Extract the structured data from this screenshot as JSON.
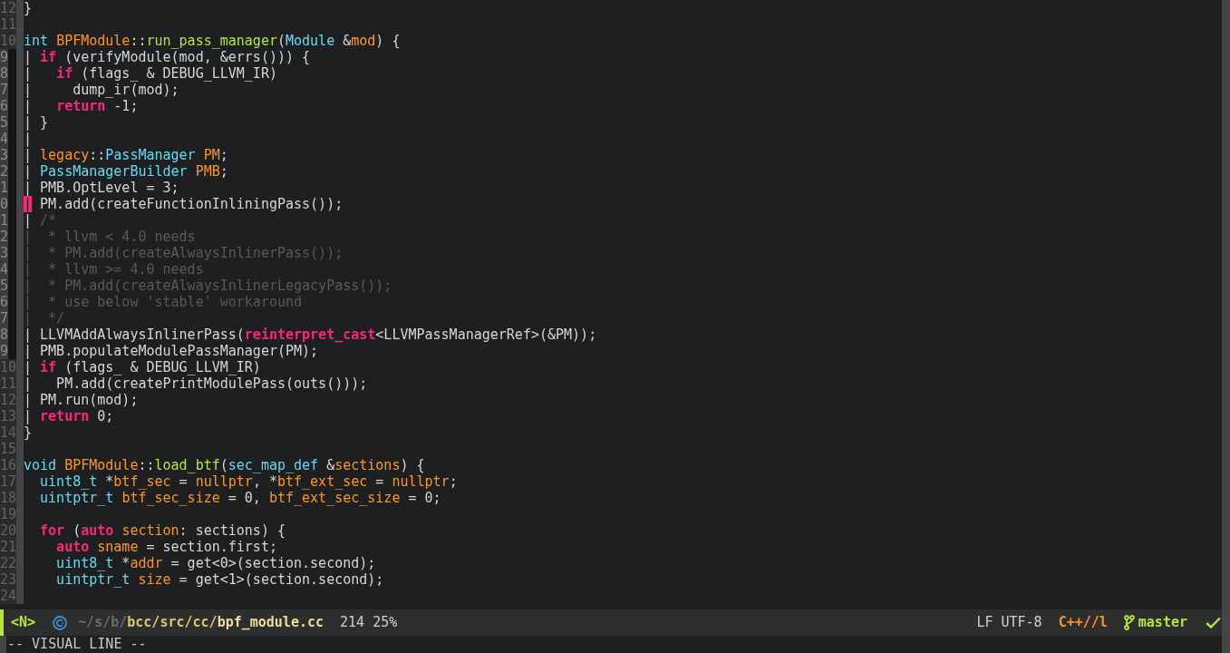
{
  "editor": {
    "lines": [
      {
        "number": "12",
        "selected": false,
        "tokens": [
          {
            "kind": "text",
            "text": "}"
          }
        ]
      },
      {
        "number": "11",
        "selected": false
      },
      {
        "number": "10",
        "selected": false,
        "tokens": [
          {
            "kind": "type",
            "text": "int "
          },
          {
            "kind": "variable",
            "text": "BPFModule"
          },
          {
            "kind": "text",
            "text": "::"
          },
          {
            "kind": "function",
            "text": "run_pass_manager"
          },
          {
            "kind": "text",
            "text": "("
          },
          {
            "kind": "type",
            "text": "Module"
          },
          {
            "kind": "text",
            "text": " &"
          },
          {
            "kind": "variable",
            "text": "mod"
          },
          {
            "kind": "text",
            "text": ") {"
          }
        ]
      },
      {
        "number": "9",
        "selected": true,
        "tokens": [
          {
            "kind": "text",
            "text": "| "
          },
          {
            "kind": "keyword",
            "text": "if"
          },
          {
            "kind": "text",
            "text": " (verifyModule(mod, &errs())) {"
          }
        ]
      },
      {
        "number": "8",
        "selected": true,
        "tokens": [
          {
            "kind": "text",
            "text": "|   "
          },
          {
            "kind": "keyword",
            "text": "if"
          },
          {
            "kind": "text",
            "text": " (flags_ & DEBUG_LLVM_IR)"
          }
        ]
      },
      {
        "number": "7",
        "selected": true,
        "tokens": [
          {
            "kind": "text",
            "text": "|     dump_ir(mod);"
          }
        ]
      },
      {
        "number": "6",
        "selected": true,
        "tokens": [
          {
            "kind": "text",
            "text": "|   "
          },
          {
            "kind": "keyword",
            "text": "return"
          },
          {
            "kind": "text",
            "text": " -1;"
          }
        ]
      },
      {
        "number": "5",
        "selected": true,
        "tokens": [
          {
            "kind": "text",
            "text": "| }"
          }
        ]
      },
      {
        "number": "4",
        "selected": true,
        "tokens": [
          {
            "kind": "text",
            "text": "|"
          }
        ]
      },
      {
        "number": "3",
        "selected": true,
        "tokens": [
          {
            "kind": "text",
            "text": "| "
          },
          {
            "kind": "variable",
            "text": "legacy"
          },
          {
            "kind": "text",
            "text": "::"
          },
          {
            "kind": "type",
            "text": "PassManager "
          },
          {
            "kind": "variable",
            "text": "PM"
          },
          {
            "kind": "text",
            "text": ";"
          }
        ]
      },
      {
        "number": "2",
        "selected": true,
        "tokens": [
          {
            "kind": "text",
            "text": "| "
          },
          {
            "kind": "type",
            "text": "PassManagerBuilder "
          },
          {
            "kind": "variable",
            "text": "PMB"
          },
          {
            "kind": "text",
            "text": ";"
          }
        ]
      },
      {
        "number": "1",
        "selected": true,
        "tokens": [
          {
            "kind": "text",
            "text": "| PMB.OptLevel = 3;"
          }
        ]
      },
      {
        "number": "0",
        "selected": true,
        "tokens": [
          {
            "kind": "cursor",
            "text": "|"
          },
          {
            "kind": "text",
            "text": " PM.add(createFunctionInliningPass());"
          }
        ]
      },
      {
        "number": "1",
        "selected": true,
        "tokens": [
          {
            "kind": "text",
            "text": "| "
          },
          {
            "kind": "comment",
            "text": "/*"
          }
        ]
      },
      {
        "number": "2",
        "selected": true,
        "tokens": [
          {
            "kind": "comment",
            "text": "|  * llvm < 4.0 needs"
          }
        ]
      },
      {
        "number": "3",
        "selected": true,
        "tokens": [
          {
            "kind": "comment",
            "text": "|  * PM.add(createAlwaysInlinerPass());"
          }
        ]
      },
      {
        "number": "4",
        "selected": true,
        "tokens": [
          {
            "kind": "comment",
            "text": "|  * llvm >= 4.0 needs"
          }
        ]
      },
      {
        "number": "5",
        "selected": true,
        "tokens": [
          {
            "kind": "comment",
            "text": "|  * PM.add(createAlwaysInlinerLegacyPass());"
          }
        ]
      },
      {
        "number": "6",
        "selected": true,
        "tokens": [
          {
            "kind": "comment",
            "text": "|  * use below 'stable' workaround"
          }
        ]
      },
      {
        "number": "7",
        "selected": true,
        "tokens": [
          {
            "kind": "comment",
            "text": "|  */"
          }
        ]
      },
      {
        "number": "8",
        "selected": true,
        "tokens": [
          {
            "kind": "text",
            "text": "| LLVMAddAlwaysInlinerPass("
          },
          {
            "kind": "keyword",
            "text": "reinterpret_cast"
          },
          {
            "kind": "text",
            "text": "<LLVMPassManagerRef>(&PM));"
          }
        ]
      },
      {
        "number": "9",
        "selected": true,
        "tokens": [
          {
            "kind": "text",
            "text": "| PMB.populateModulePassManager(PM);"
          }
        ]
      },
      {
        "number": "10",
        "selected": false,
        "tokens": [
          {
            "kind": "text",
            "text": "| "
          },
          {
            "kind": "keyword",
            "text": "if"
          },
          {
            "kind": "text",
            "text": " (flags_ & DEBUG_LLVM_IR)"
          }
        ]
      },
      {
        "number": "11",
        "selected": false,
        "tokens": [
          {
            "kind": "text",
            "text": "|   PM.add(createPrintModulePass(outs()));"
          }
        ]
      },
      {
        "number": "12",
        "selected": false,
        "tokens": [
          {
            "kind": "text",
            "text": "| PM.run(mod);"
          }
        ]
      },
      {
        "number": "13",
        "selected": false,
        "tokens": [
          {
            "kind": "text",
            "text": "| "
          },
          {
            "kind": "keyword",
            "text": "return"
          },
          {
            "kind": "text",
            "text": " 0;"
          }
        ]
      },
      {
        "number": "14",
        "selected": false,
        "tokens": [
          {
            "kind": "text",
            "text": "}"
          }
        ]
      },
      {
        "number": "15",
        "selected": false
      },
      {
        "number": "16",
        "selected": false,
        "tokens": [
          {
            "kind": "type",
            "text": "void "
          },
          {
            "kind": "variable",
            "text": "BPFModule"
          },
          {
            "kind": "text",
            "text": "::"
          },
          {
            "kind": "function",
            "text": "load_btf"
          },
          {
            "kind": "text",
            "text": "("
          },
          {
            "kind": "type",
            "text": "sec_map_def"
          },
          {
            "kind": "text",
            "text": " &"
          },
          {
            "kind": "variable",
            "text": "sections"
          },
          {
            "kind": "text",
            "text": ") {"
          }
        ]
      },
      {
        "number": "17",
        "selected": false,
        "tokens": [
          {
            "kind": "type",
            "text": "  uint8_t"
          },
          {
            "kind": "text",
            "text": " *"
          },
          {
            "kind": "variable",
            "text": "btf_sec"
          },
          {
            "kind": "text",
            "text": " = "
          },
          {
            "kind": "variable",
            "text": "nullptr"
          },
          {
            "kind": "text",
            "text": ", *"
          },
          {
            "kind": "variable",
            "text": "btf_ext_sec"
          },
          {
            "kind": "text",
            "text": " = "
          },
          {
            "kind": "variable",
            "text": "nullptr"
          },
          {
            "kind": "text",
            "text": ";"
          }
        ]
      },
      {
        "number": "18",
        "selected": false,
        "tokens": [
          {
            "kind": "type",
            "text": "  uintptr_t "
          },
          {
            "kind": "variable",
            "text": "btf_sec_size"
          },
          {
            "kind": "text",
            "text": " = 0, "
          },
          {
            "kind": "variable",
            "text": "btf_ext_sec_size"
          },
          {
            "kind": "text",
            "text": " = 0;"
          }
        ]
      },
      {
        "number": "19",
        "selected": false
      },
      {
        "number": "20",
        "selected": false,
        "tokens": [
          {
            "kind": "keyword",
            "text": "  for"
          },
          {
            "kind": "text",
            "text": " ("
          },
          {
            "kind": "keyword",
            "text": "auto "
          },
          {
            "kind": "variable",
            "text": "section"
          },
          {
            "kind": "text",
            "text": ": sections) {"
          }
        ]
      },
      {
        "number": "21",
        "selected": false,
        "tokens": [
          {
            "kind": "keyword",
            "text": "    auto "
          },
          {
            "kind": "variable",
            "text": "sname"
          },
          {
            "kind": "text",
            "text": " = section.first;"
          }
        ]
      },
      {
        "number": "22",
        "selected": false,
        "tokens": [
          {
            "kind": "type",
            "text": "    uint8_t"
          },
          {
            "kind": "text",
            "text": " *"
          },
          {
            "kind": "variable",
            "text": "addr"
          },
          {
            "kind": "text",
            "text": " = get<0>(section.second);"
          }
        ]
      },
      {
        "number": "23",
        "selected": false,
        "tokens": [
          {
            "kind": "type",
            "text": "    uintptr_t "
          },
          {
            "kind": "variable",
            "text": "size"
          },
          {
            "kind": "text",
            "text": " = get<1>(section.second);"
          }
        ]
      },
      {
        "number": "24",
        "selected": false
      }
    ]
  },
  "mode_line": {
    "state": "<N>",
    "path": {
      "prefix": "~/s/b/",
      "directory": "bcc/src/cc/",
      "file": "bpf_module.cc"
    },
    "position": "214 25%",
    "encoding": "LF UTF-8",
    "mode": "C++//l",
    "branch": "master"
  },
  "minibuffer": {
    "message": "-- VISUAL LINE --"
  }
}
